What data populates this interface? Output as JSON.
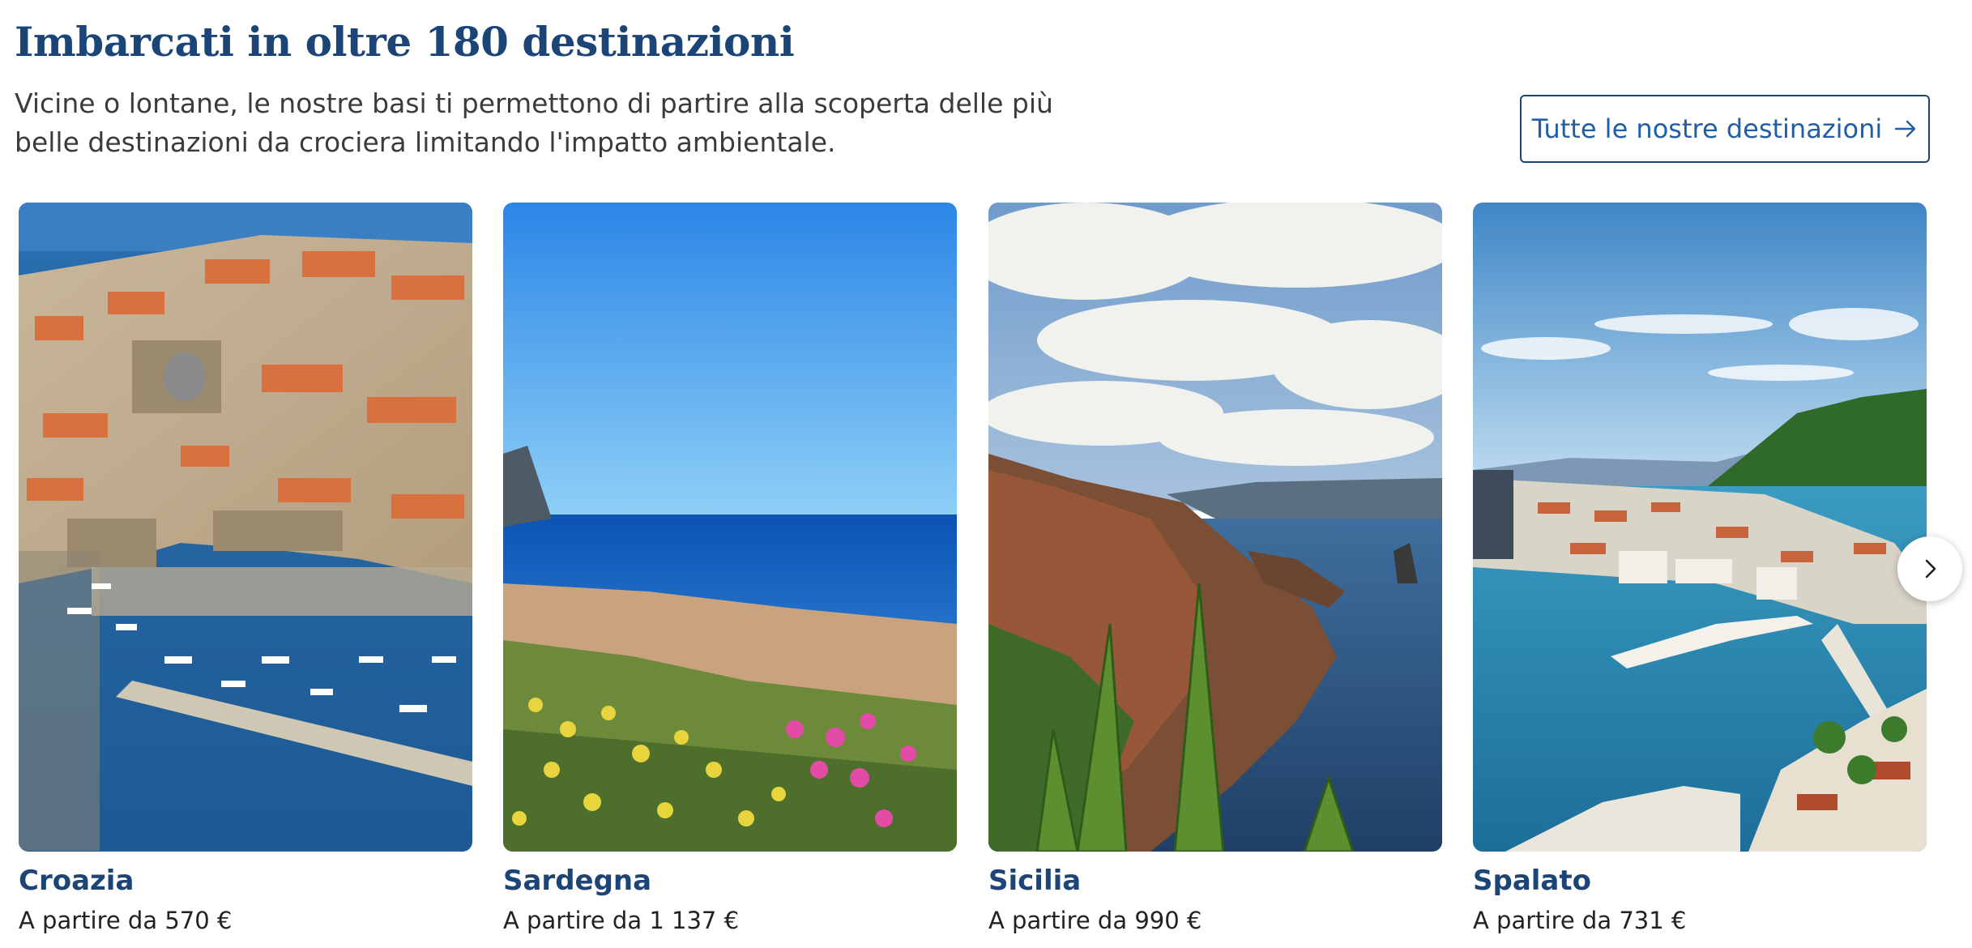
{
  "header": {
    "title": "Imbarcati in oltre 180 destinazioni",
    "subtitle": "Vicine o lontane, le nostre basi ti permettono di partire alla scoperta delle più belle destinazioni da crociera limitando l'impatto ambientale.",
    "cta_label": "Tutte le nostre destinazioni",
    "cta_icon": "arrow-right-icon"
  },
  "destinations": [
    {
      "name": "Croazia",
      "price": "A partire da 570 €",
      "image": "dubrovnik-harbour-photo"
    },
    {
      "name": "Sardegna",
      "price": "A partire da 1 137 €",
      "image": "sardinia-coast-photo"
    },
    {
      "name": "Sicilia",
      "price": "A partire da 990 €",
      "image": "sicily-cliffs-photo"
    },
    {
      "name": "Spalato",
      "price": "A partire da 731 €",
      "image": "split-harbour-photo"
    }
  ],
  "carousel": {
    "next_icon": "chevron-right-icon"
  },
  "colors": {
    "brand": "#1c4577",
    "link": "#1f5fa8",
    "text": "#3b3b3b"
  }
}
